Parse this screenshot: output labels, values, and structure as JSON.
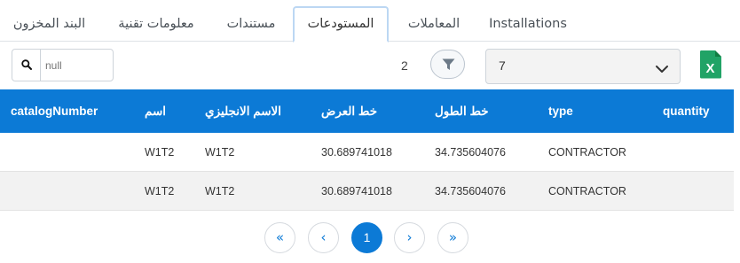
{
  "tabs": [
    {
      "label": "البند المخزون"
    },
    {
      "label": "معلومات تقنية"
    },
    {
      "label": "مستندات"
    },
    {
      "label": "المستودعات",
      "active": true
    },
    {
      "label": "المعاملات"
    },
    {
      "label": "Installations"
    }
  ],
  "toolbar": {
    "excel_icon": "excel-file-icon",
    "select_value": "7",
    "filter_icon": "funnel-icon",
    "count": "2",
    "search_placeholder": "null",
    "search_icon": "search-icon"
  },
  "table": {
    "headers": [
      "catalogNumber",
      "اسم",
      "الاسم الانجليزي",
      "خط العرض",
      "خط الطول",
      "type",
      "quantity"
    ],
    "rows": [
      [
        "",
        "W1T2",
        "W1T2",
        "30.689741018",
        "34.735604076",
        "CONTRACTOR",
        ""
      ],
      [
        "",
        "W1T2",
        "W1T2",
        "30.689741018",
        "34.735604076",
        "CONTRACTOR",
        ""
      ]
    ]
  },
  "pagination": {
    "first": "«",
    "prev": "‹",
    "current": "1",
    "next": "›",
    "last": "»"
  },
  "colors": {
    "accent": "#0c7ad6",
    "excel_green": "#21a366"
  }
}
